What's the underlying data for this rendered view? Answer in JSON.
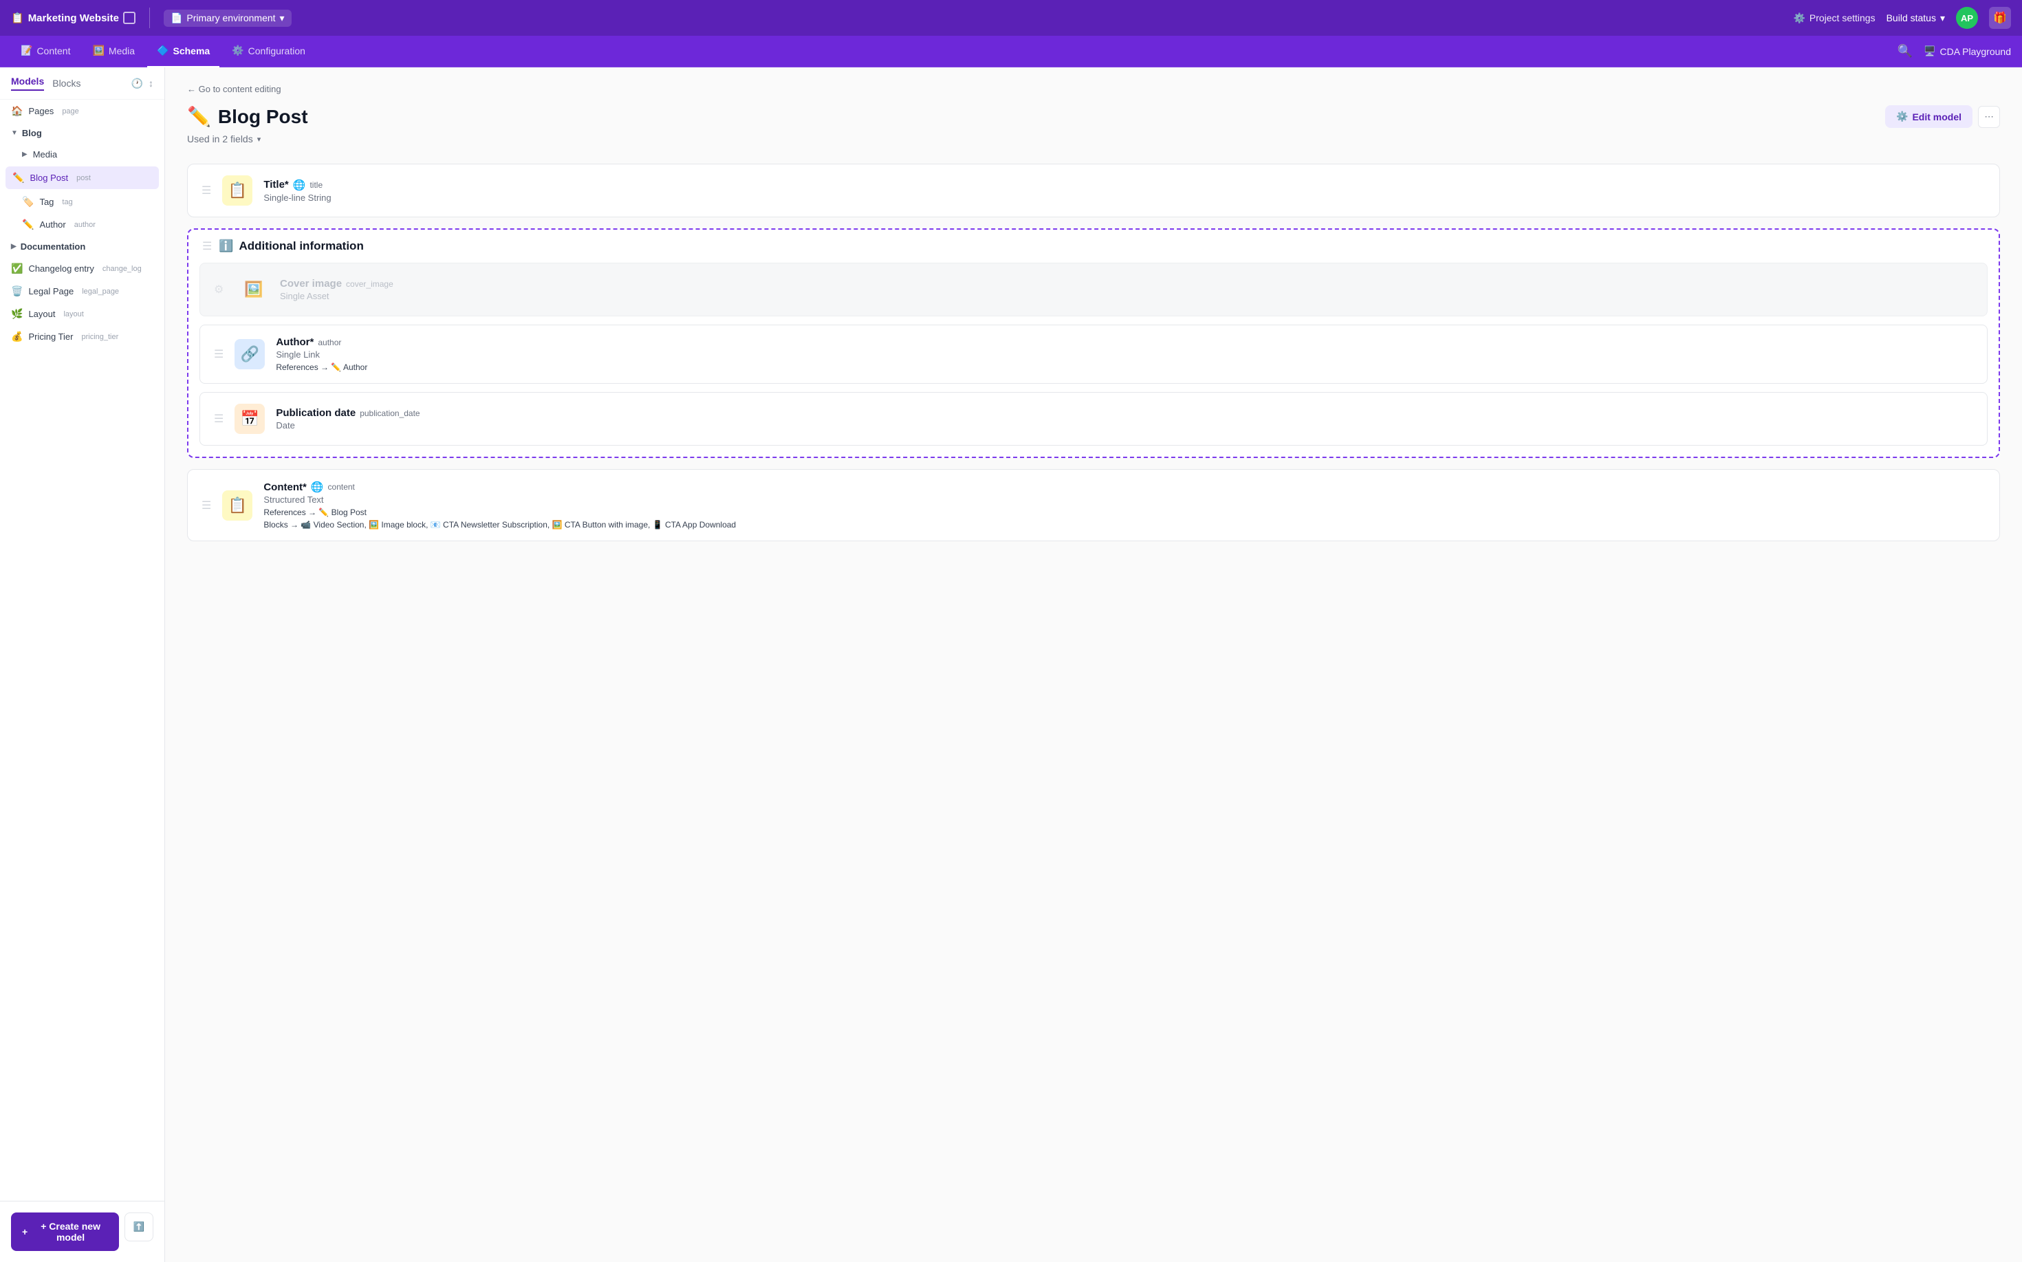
{
  "topNav": {
    "projectName": "Marketing Website",
    "projectIcon": "📋",
    "envLabel": "Primary environment",
    "envIcon": "📄",
    "projectSettings": "Project settings",
    "buildStatus": "Build status",
    "avatarInitials": "AP",
    "giftIcon": "🎁"
  },
  "secondNav": {
    "tabs": [
      {
        "id": "content",
        "label": "Content",
        "icon": "📝",
        "active": false
      },
      {
        "id": "media",
        "label": "Media",
        "icon": "🖼️",
        "active": false
      },
      {
        "id": "schema",
        "label": "Schema",
        "icon": "🔷",
        "active": true
      },
      {
        "id": "configuration",
        "label": "Configuration",
        "icon": "⚙️",
        "active": false
      }
    ],
    "cdaPlayground": "CDA Playground"
  },
  "sidebar": {
    "modelsTab": "Models",
    "blocksTab": "Blocks",
    "items": [
      {
        "id": "pages",
        "name": "Pages",
        "apiId": "page",
        "icon": "🏠",
        "indent": 0,
        "hasChevron": false
      },
      {
        "id": "blog",
        "name": "Blog",
        "apiId": "",
        "icon": "",
        "indent": 0,
        "isSection": true,
        "expanded": true
      },
      {
        "id": "media",
        "name": "Media",
        "apiId": "",
        "icon": "",
        "indent": 1,
        "hasChevronRight": true
      },
      {
        "id": "blogpost",
        "name": "Blog Post",
        "apiId": "post",
        "icon": "✏️",
        "indent": 1,
        "active": true
      },
      {
        "id": "tag",
        "name": "Tag",
        "apiId": "tag",
        "icon": "🏷️",
        "indent": 1
      },
      {
        "id": "author",
        "name": "Author",
        "apiId": "author",
        "icon": "✏️",
        "indent": 1
      },
      {
        "id": "documentation",
        "name": "Documentation",
        "apiId": "",
        "icon": "",
        "indent": 0,
        "isSection": true,
        "expanded": false
      },
      {
        "id": "changelog",
        "name": "Changelog entry",
        "apiId": "change_log",
        "icon": "✅",
        "indent": 0
      },
      {
        "id": "legalpage",
        "name": "Legal Page",
        "apiId": "legal_page",
        "icon": "🗑️",
        "indent": 0
      },
      {
        "id": "layout",
        "name": "Layout",
        "apiId": "layout",
        "icon": "🌿",
        "indent": 0
      },
      {
        "id": "pricingtier",
        "name": "Pricing Tier",
        "apiId": "pricing_tier",
        "icon": "💰",
        "indent": 0
      }
    ],
    "createNewModel": "+ Create new model"
  },
  "modelPage": {
    "backLink": "← Go to content editing",
    "modelIcon": "✏️",
    "modelName": "Blog Post",
    "usedIn": "Used in 2 fields",
    "editModelBtn": "Edit model",
    "moreIcon": "⋯",
    "fields": [
      {
        "id": "title-field",
        "icon": "📋",
        "iconColor": "yellow",
        "name": "Title*",
        "localeIcon": "🌐",
        "apiId": "title",
        "type": "Single-line String",
        "isDraggable": true
      }
    ],
    "group": {
      "icon": "ℹ️",
      "name": "Additional information",
      "fields": [
        {
          "id": "cover-image-field",
          "icon": "🖼️",
          "iconColor": "gray",
          "name": "Cover image",
          "apiId": "cover_image",
          "type": "Single Asset",
          "isDraggable": false,
          "isGhost": true
        },
        {
          "id": "author-field",
          "icon": "🔗",
          "iconColor": "blue",
          "name": "Author*",
          "apiId": "author",
          "type": "Single Link",
          "reference": "References → ✏️ Author",
          "isDraggable": true
        },
        {
          "id": "pub-date-field",
          "icon": "📅",
          "iconColor": "orange",
          "name": "Publication date",
          "apiId": "publication_date",
          "type": "Date",
          "isDraggable": true
        }
      ]
    },
    "contentField": {
      "id": "content-field",
      "icon": "📋",
      "iconColor": "yellow",
      "name": "Content*",
      "localeIcon": "🌐",
      "apiId": "content",
      "type": "Structured Text",
      "reference": "References → ✏️ Blog Post",
      "blocks": "Blocks → 📹 Video Section, 🖼️ Image block, 📧 CTA Newsletter Subscription, 🖼️ CTA Button with image, 📱 CTA App Download"
    }
  }
}
